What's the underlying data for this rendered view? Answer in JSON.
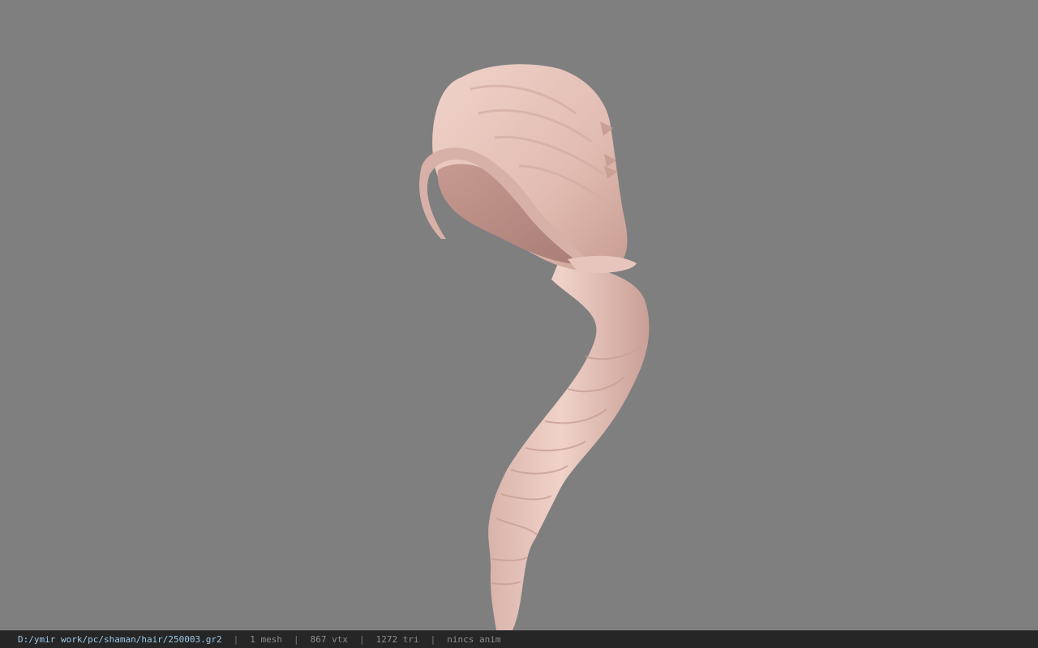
{
  "viewport": {
    "background_color": "#7f7f7f",
    "model_color": "#e6c4bb",
    "model_description_icon": "hair-mesh"
  },
  "status_bar": {
    "file_path": "D:/ymir work/pc/shaman/hair/250003.gr2",
    "separator": "|",
    "mesh_count": "1 mesh",
    "vertex_count": "867 vtx",
    "triangle_count": "1272 tri",
    "animation": "nincs anim"
  }
}
